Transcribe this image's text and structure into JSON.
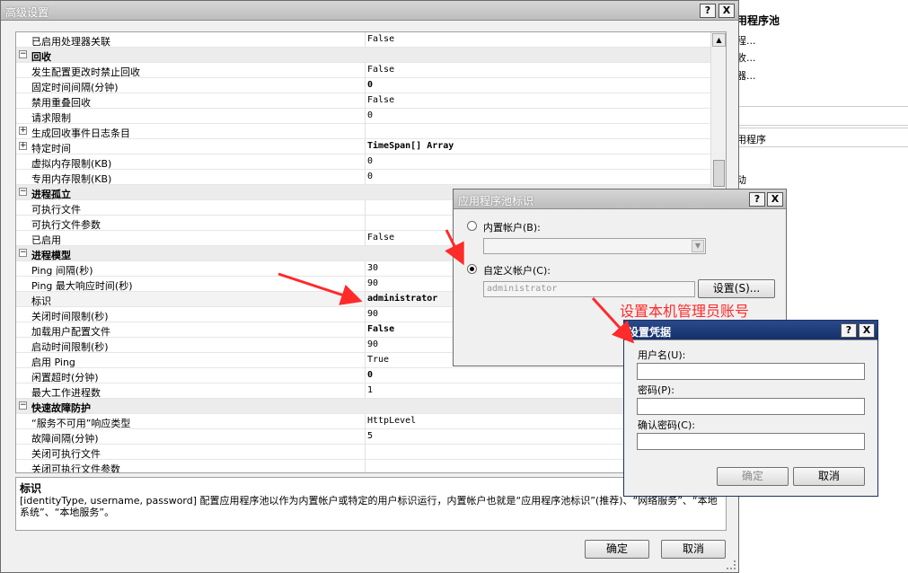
{
  "background": {
    "header": "用程序池",
    "links": [
      "程...",
      "收...",
      "器..."
    ],
    "section1": "用程序",
    "section2": "动"
  },
  "main_dialog": {
    "title": "高级设置",
    "help": "?",
    "close": "X",
    "rows": [
      {
        "type": "prop",
        "name": "已启用处理器关联",
        "value": "False",
        "bold": false
      },
      {
        "type": "cat",
        "name": "回收",
        "exp": "⊟"
      },
      {
        "type": "prop",
        "name": "发生配置更改时禁止回收",
        "value": "False",
        "bold": false
      },
      {
        "type": "prop",
        "name": "固定时间间隔(分钟)",
        "value": "0",
        "bold": true
      },
      {
        "type": "prop",
        "name": "禁用重叠回收",
        "value": "False",
        "bold": false
      },
      {
        "type": "prop",
        "name": "请求限制",
        "value": "0",
        "bold": false
      },
      {
        "type": "sub",
        "name": "生成回收事件日志条目",
        "value": "",
        "exp": "⊞"
      },
      {
        "type": "sub",
        "name": "特定时间",
        "value": "TimeSpan[] Array",
        "bold": true,
        "exp": "⊞"
      },
      {
        "type": "prop",
        "name": "虚拟内存限制(KB)",
        "value": "0",
        "bold": false
      },
      {
        "type": "prop",
        "name": "专用内存限制(KB)",
        "value": "0",
        "bold": false
      },
      {
        "type": "cat",
        "name": "进程孤立",
        "exp": "⊟"
      },
      {
        "type": "prop",
        "name": "可执行文件",
        "value": "",
        "bold": false
      },
      {
        "type": "prop",
        "name": "可执行文件参数",
        "value": "",
        "bold": false
      },
      {
        "type": "prop",
        "name": "已启用",
        "value": "False",
        "bold": false
      },
      {
        "type": "cat",
        "name": "进程模型",
        "exp": "⊟"
      },
      {
        "type": "prop",
        "name": "Ping 间隔(秒)",
        "value": "30",
        "bold": false
      },
      {
        "type": "prop",
        "name": "Ping 最大响应时间(秒)",
        "value": "90",
        "bold": false
      },
      {
        "type": "sel",
        "name": "标识",
        "value": "administrator",
        "bold": true
      },
      {
        "type": "prop",
        "name": "关闭时间限制(秒)",
        "value": "90",
        "bold": false
      },
      {
        "type": "prop",
        "name": "加载用户配置文件",
        "value": "False",
        "bold": true
      },
      {
        "type": "prop",
        "name": "启动时间限制(秒)",
        "value": "90",
        "bold": false
      },
      {
        "type": "prop",
        "name": "启用 Ping",
        "value": "True",
        "bold": false
      },
      {
        "type": "prop",
        "name": "闲置超时(分钟)",
        "value": "0",
        "bold": true
      },
      {
        "type": "prop",
        "name": "最大工作进程数",
        "value": "1",
        "bold": false
      },
      {
        "type": "cat",
        "name": "快速故障防护",
        "exp": "⊟"
      },
      {
        "type": "prop",
        "name": "“服务不可用”响应类型",
        "value": "HttpLevel",
        "bold": false
      },
      {
        "type": "prop",
        "name": "故障间隔(分钟)",
        "value": "5",
        "bold": false
      },
      {
        "type": "prop",
        "name": "关闭可执行文件",
        "value": "",
        "bold": false
      },
      {
        "type": "prop",
        "name": "关闭可执行文件参数",
        "value": "",
        "bold": false
      }
    ],
    "description_title": "标识",
    "description_text": "[identityType, username, password] 配置应用程序池以作为内置帐户或特定的用户标识运行，内置帐户也就是“应用程序池标识”(推荐)、“网络服务”、“本地系统”、“本地服务”。",
    "ok": "确定",
    "cancel": "取消"
  },
  "identity_dialog": {
    "title": "应用程序池标识",
    "help": "?",
    "close": "X",
    "builtin_label": "内置帐户(B):",
    "custom_label": "自定义帐户(C):",
    "account_value": "administrator",
    "set_button": "设置(S)...",
    "custom_selected": true
  },
  "credentials_dialog": {
    "title": "设置凭据",
    "help": "?",
    "close": "X",
    "username_label": "用户名(U):",
    "password_label": "密码(P):",
    "confirm_label": "确认密码(C):",
    "username_value": "",
    "ok": "确定",
    "cancel": "取消"
  },
  "annotation": {
    "text": "设置本机管理员账号",
    "color": "#ff2a2a"
  }
}
